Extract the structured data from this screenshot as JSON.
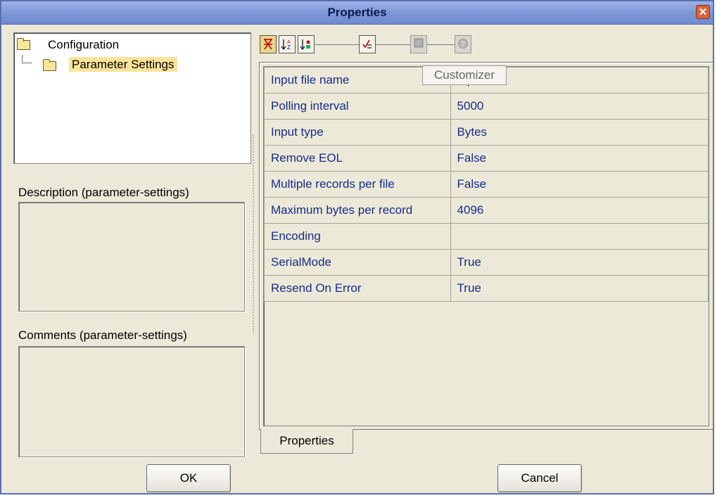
{
  "window": {
    "title": "Properties",
    "close_glyph": "✕"
  },
  "tree": {
    "root_label": "Configuration",
    "child_label": "Parameter Settings"
  },
  "description": {
    "label": "Description (parameter-settings)"
  },
  "comments": {
    "label": "Comments (parameter-settings)"
  },
  "toolbar": {
    "buttons": [
      "sort-by-category-icon",
      "sort-alphabetical-icon",
      "sort-by-type-icon",
      "checklist-icon",
      "customizer-icon",
      "help-icon"
    ],
    "tooltip": "Customizer"
  },
  "properties": {
    "rows": [
      {
        "name": "Input file name",
        "value": "Input.txt"
      },
      {
        "name": "Polling interval",
        "value": "5000"
      },
      {
        "name": "Input type",
        "value": "Bytes"
      },
      {
        "name": "Remove EOL",
        "value": "False"
      },
      {
        "name": "Multiple records per file",
        "value": "False"
      },
      {
        "name": "Maximum bytes per record",
        "value": "4096"
      },
      {
        "name": "Encoding",
        "value": ""
      },
      {
        "name": "SerialMode",
        "value": "True"
      },
      {
        "name": "Resend On Error",
        "value": "True"
      }
    ]
  },
  "tab": {
    "label": "Properties"
  },
  "buttons": {
    "ok": "OK",
    "cancel": "Cancel"
  },
  "colors": {
    "value_text": "#142c8c",
    "titlebar": "#7d98d8",
    "selection": "#fbe49a"
  }
}
